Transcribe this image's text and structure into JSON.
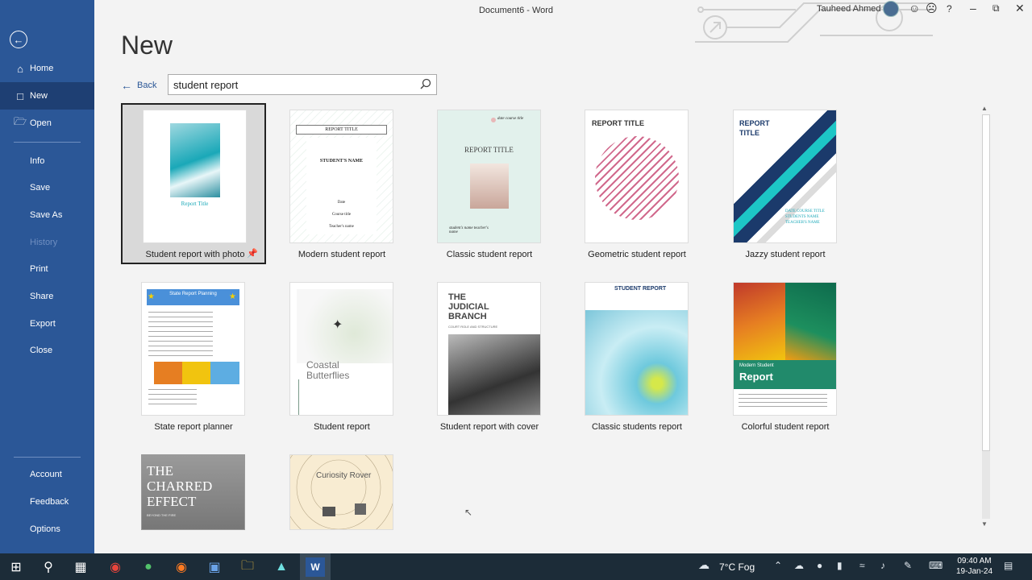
{
  "titlebar": {
    "document_title": "Document6  -  Word",
    "user_name": "Tauheed Ahmed",
    "help": "?"
  },
  "sidebar": {
    "items": [
      {
        "label": "Home",
        "icon": "home-icon"
      },
      {
        "label": "New",
        "icon": "new-document-icon"
      },
      {
        "label": "Open",
        "icon": "folder-open-icon"
      },
      {
        "label": "Info"
      },
      {
        "label": "Save"
      },
      {
        "label": "Save As"
      },
      {
        "label": "History"
      },
      {
        "label": "Print"
      },
      {
        "label": "Share"
      },
      {
        "label": "Export"
      },
      {
        "label": "Close"
      }
    ],
    "bottom": [
      {
        "label": "Account"
      },
      {
        "label": "Feedback"
      },
      {
        "label": "Options"
      }
    ]
  },
  "main": {
    "page_title": "New",
    "back_label": "Back",
    "search_value": "student report"
  },
  "templates": [
    {
      "label": "Student report with photo",
      "selected": true,
      "thumb_title": "Report Title"
    },
    {
      "label": "Modern student report",
      "thumb_title": "REPORT TITLE",
      "thumb_sub": "STUDENT'S NAME",
      "thumb_lines": [
        "Date",
        "Course title",
        "Teacher's name"
      ]
    },
    {
      "label": "Classic student report",
      "thumb_title": "REPORT TITLE",
      "thumb_top": "date course title",
      "thumb_foot": "student's name teacher's name"
    },
    {
      "label": "Geometric student report",
      "thumb_title": "REPORT TITLE"
    },
    {
      "label": "Jazzy student report",
      "thumb_title": "REPORT TITLE",
      "thumb_foot": "DATE COURSE TITLE STUDENTS NAME TEACHER'S NAME"
    },
    {
      "label": "State report planner",
      "thumb_title": "State Report Planning"
    },
    {
      "label": "Student report",
      "thumb_title": "Coastal Butterflies"
    },
    {
      "label": "Student report with cover",
      "thumb_title": "THE JUDICIAL BRANCH",
      "thumb_sub": "COURT ROLE AND STRUCTURE"
    },
    {
      "label": "Classic students report",
      "thumb_title": "STUDENT REPORT"
    },
    {
      "label": "Colorful student report",
      "thumb_title": "Report",
      "thumb_sub": "Modern Student"
    },
    {
      "label": "",
      "thumb_title": "THE CHARRED EFFECT",
      "thumb_sub": "BEYOND THE FIRE"
    },
    {
      "label": "",
      "thumb_title": "Curiosity Rover"
    }
  ],
  "taskbar": {
    "weather": "7°C  Fog",
    "time": "09:40 AM",
    "date": "19-Jan-24"
  },
  "colors": {
    "sidebar": "#2b5797",
    "sidebar_active": "#1e3f73",
    "taskbar": "#1c2c38"
  }
}
